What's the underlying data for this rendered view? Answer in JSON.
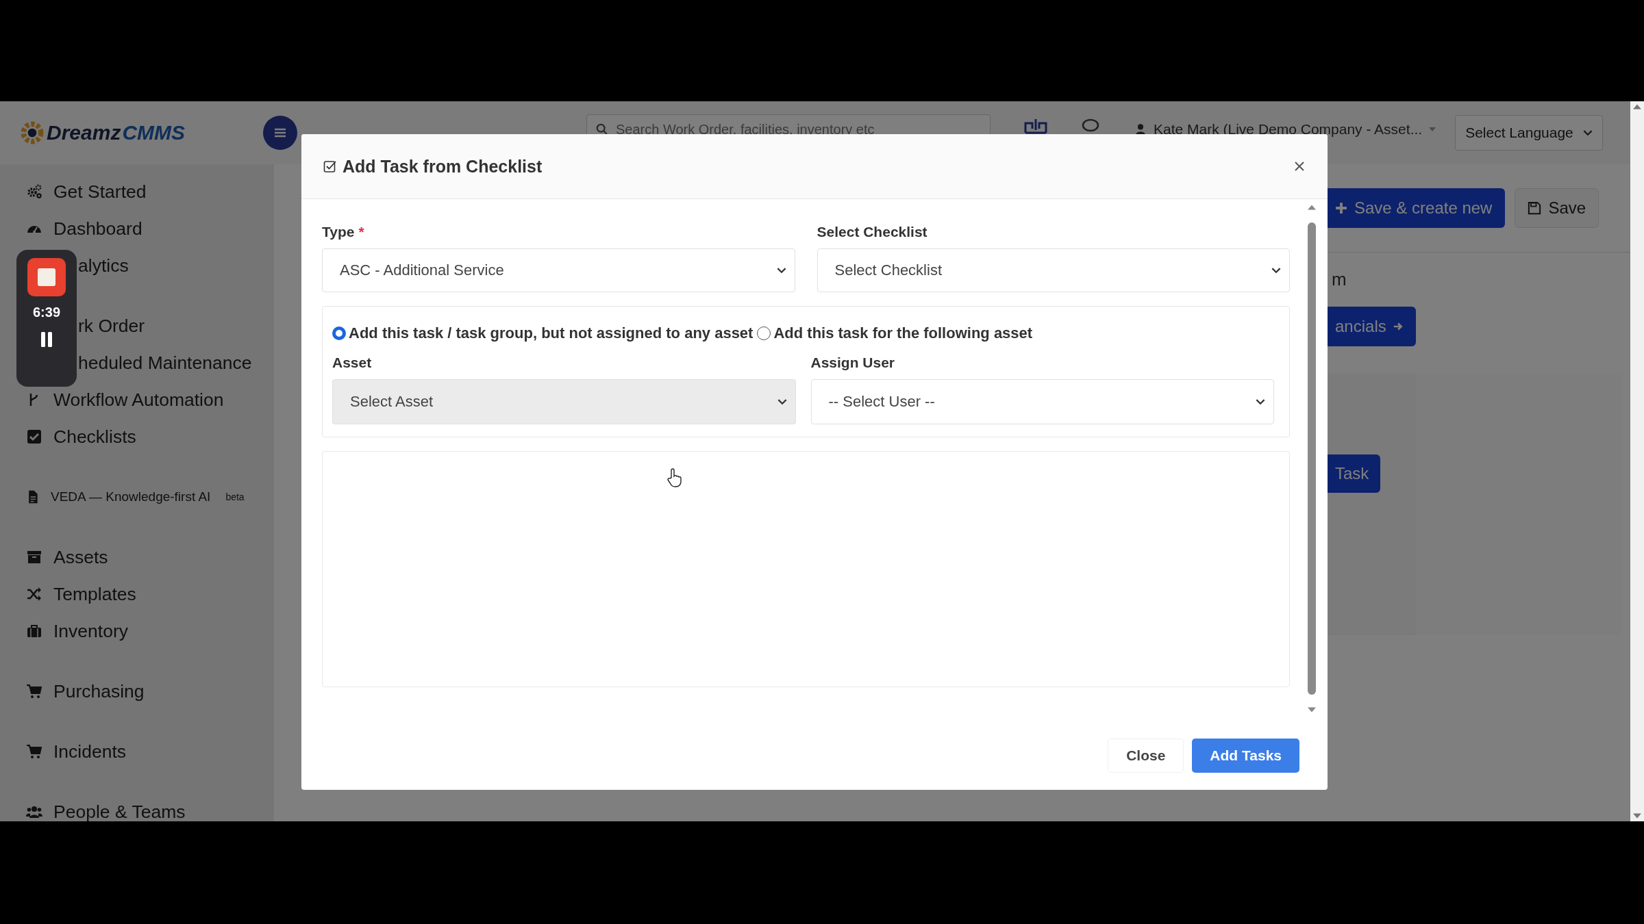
{
  "recorder": {
    "time": "6:39"
  },
  "header": {
    "logo": {
      "part_1": "Dreamz",
      "part_2": "CMMS"
    },
    "search": {
      "placeholder": "Search Work Order, facilities, inventory etc"
    },
    "user": "Kate Mark (Live Demo Company - Asset...",
    "language": "Select Language"
  },
  "sidebar": {
    "sections": [
      {
        "items": [
          {
            "label": "Get Started",
            "kind": "link"
          },
          {
            "label": "Dashboard",
            "kind": "link"
          },
          {
            "label": "alytics",
            "kind": "covered"
          }
        ]
      },
      {
        "items": [
          {
            "label": "rk Order",
            "kind": "covered"
          },
          {
            "label": "heduled Maintenance",
            "kind": "covered"
          },
          {
            "label": "Workflow Automation",
            "kind": "link"
          },
          {
            "label": "Checklists",
            "kind": "link"
          }
        ]
      },
      {
        "items": [
          {
            "label": "VEDA — Knowledge-first AI",
            "badge": "beta",
            "kind": "small"
          }
        ]
      },
      {
        "items": [
          {
            "label": "Assets",
            "kind": "link"
          },
          {
            "label": "Templates",
            "kind": "link"
          },
          {
            "label": "Inventory",
            "kind": "link"
          }
        ]
      },
      {
        "items": [
          {
            "label": "Purchasing",
            "kind": "link"
          }
        ]
      },
      {
        "items": [
          {
            "label": "Incidents",
            "kind": "link"
          }
        ]
      },
      {
        "items": [
          {
            "label": "People & Teams",
            "kind": "link"
          }
        ]
      }
    ]
  },
  "page": {
    "actions": [
      {
        "label": "Save & create new",
        "kind": "primary"
      },
      {
        "label": "Save",
        "kind": "secondary"
      }
    ],
    "tab_fragment": "m",
    "next_button": "ancials",
    "task_button": "Task"
  },
  "modal": {
    "title": "Add Task from Checklist",
    "fields": [
      {
        "label": "Type",
        "required_mark": "*",
        "value": "ASC - Additional Service"
      },
      {
        "label": "Select Checklist",
        "value": "Select Checklist"
      }
    ],
    "assignment": {
      "options": [
        {
          "label": "Add this task / task group, but not assigned to any asset",
          "selected": true
        },
        {
          "label": "Add this task for the following asset",
          "selected": false
        }
      ],
      "fields": [
        {
          "label": "Asset",
          "value": "Select Asset",
          "disabled": true
        },
        {
          "label": "Assign User",
          "value": "-- Select User --",
          "disabled": false
        }
      ]
    },
    "buttons": [
      {
        "label": "Close",
        "kind": "secondary"
      },
      {
        "label": "Add Tasks",
        "kind": "primary"
      }
    ]
  }
}
